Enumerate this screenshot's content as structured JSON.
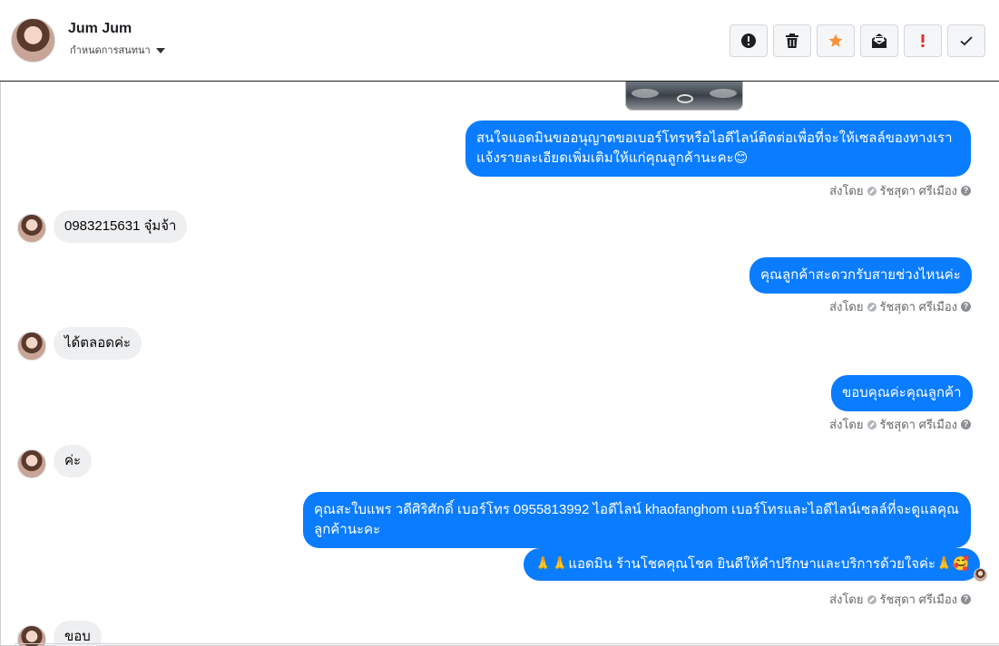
{
  "header": {
    "contact_name": "Jum Jum",
    "label_dropdown": "กำหนดการสนทนา",
    "actions": [
      {
        "name": "spam-button",
        "icon": "alert-circle-icon",
        "color": "#1c1e21"
      },
      {
        "name": "delete-button",
        "icon": "trash-icon",
        "color": "#1c1e21"
      },
      {
        "name": "star-button",
        "icon": "star-icon",
        "color": "#f7923a"
      },
      {
        "name": "mark-unread-button",
        "icon": "envelope-open-icon",
        "color": "#1c1e21"
      },
      {
        "name": "important-button",
        "icon": "exclamation-icon",
        "color": "#e02f2f"
      },
      {
        "name": "done-button",
        "icon": "check-icon",
        "color": "#1c1e21"
      }
    ]
  },
  "messages": {
    "m1": "สนใจแอดมินขออนุญาตขอเบอร์โทรหรือไอดีไลน์ติดต่อเพื่อที่จะให้เซลล์ของทางเรา แจ้งรายละเอียดเพิ่มเติมให้แก่คุณลูกค้านะคะ😊",
    "m2": "0983215631 จุ๋มจ้า",
    "m3": "คุณลูกค้าสะดวกรับสายช่วงไหนค่ะ",
    "m4": "ได้ตลอดค่ะ",
    "m5": "ขอบคุณค่ะคุณลูกค้า",
    "m6": "ค่ะ",
    "m7": "คุณสะใบแพร วดีศิริศักดิ์ เบอร์โทร 0955813992  ไอดีไลน์  khaofanghom   เบอร์โทรและไอดีไลน์เซลล์ที่จะดูแลคุณลูกค้านะคะ",
    "m8": "🙏🙏แอดมิน ร้านโชคคุณโชค ยินดีให้คำปรึกษาและบริการด้วยใจค่ะ🙏🥰",
    "m9": "ขอบ"
  },
  "sent_by": {
    "prefix": "ส่งโดย",
    "agent": "รัชสุดา ศรีเมือง",
    "help": "?"
  },
  "colors": {
    "outgoing_bubble": "#0a7cff",
    "incoming_bubble": "#eeeff1",
    "meta_text": "#65676b"
  }
}
